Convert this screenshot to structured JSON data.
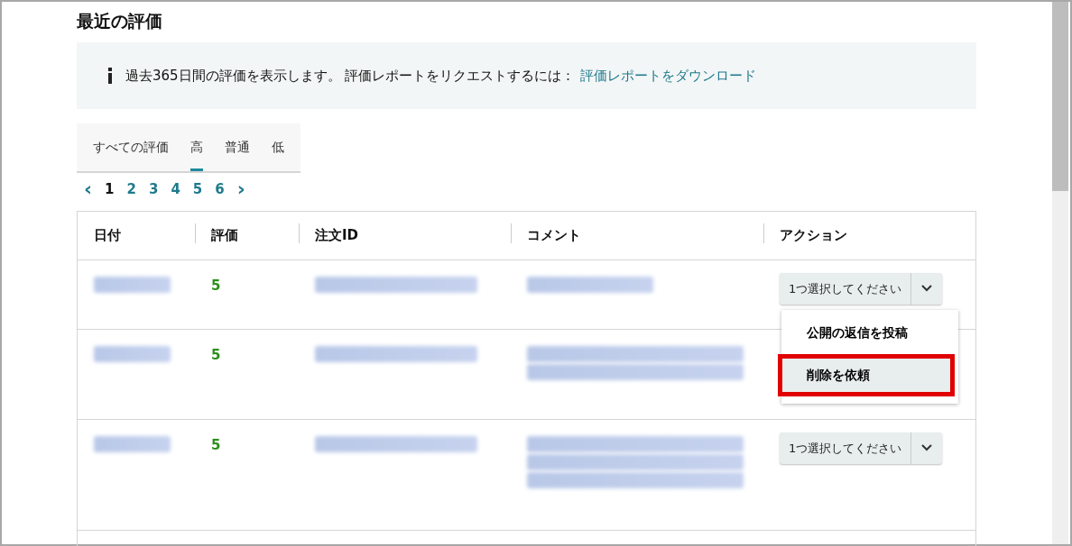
{
  "title": "最近の評価",
  "info": {
    "text": "過去365日間の評価を表示します。 評価レポートをリクエストするには：",
    "link": "評価レポートをダウンロード"
  },
  "tabs": [
    {
      "label": "すべての評価",
      "selected": false
    },
    {
      "label": "高",
      "selected": true
    },
    {
      "label": "普通",
      "selected": false
    },
    {
      "label": "低",
      "selected": false
    }
  ],
  "pagination": {
    "prev": "‹",
    "next": "›",
    "pages": [
      {
        "label": "1",
        "selected": true
      },
      {
        "label": "2",
        "selected": false
      },
      {
        "label": "3",
        "selected": false
      },
      {
        "label": "4",
        "selected": false
      },
      {
        "label": "5",
        "selected": false
      },
      {
        "label": "6",
        "selected": false
      }
    ]
  },
  "table": {
    "columns": [
      "日付",
      "評価",
      "注文ID",
      "コメント",
      "アクション"
    ],
    "rows": [
      {
        "rating": "5",
        "action": {
          "label": "1つ選択してください",
          "menu": [
            {
              "label": "公開の返信を投稿",
              "selected": false
            },
            {
              "label": "削除を依頼",
              "selected": true
            }
          ]
        }
      },
      {
        "rating": "5"
      },
      {
        "rating": "5",
        "action": {
          "label": "1つ選択してください"
        }
      }
    ]
  }
}
